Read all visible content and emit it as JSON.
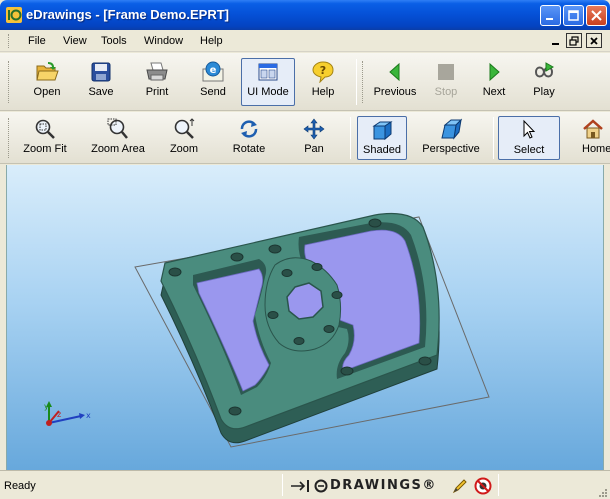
{
  "window": {
    "title": "eDrawings - [Frame Demo.EPRT]"
  },
  "menu": {
    "items": [
      "File",
      "View",
      "Tools",
      "Window",
      "Help"
    ]
  },
  "toolbar1": {
    "open": "Open",
    "save": "Save",
    "print": "Print",
    "send": "Send",
    "ui_mode": "UI Mode",
    "help": "Help",
    "previous": "Previous",
    "stop": "Stop",
    "next": "Next",
    "play": "Play"
  },
  "toolbar2": {
    "zoom_fit": "Zoom Fit",
    "zoom_area": "Zoom Area",
    "zoom": "Zoom",
    "rotate": "Rotate",
    "pan": "Pan",
    "shaded": "Shaded",
    "perspective": "Perspective",
    "select": "Select",
    "home": "Home"
  },
  "status": {
    "text": "Ready",
    "brand": "DRAWINGS®"
  },
  "triad": {
    "x": "x",
    "y": "y",
    "z": "z"
  },
  "colors": {
    "accent": "#0a5fe6",
    "part": "#4a8c7e",
    "face": "#9a97ee",
    "viewport_top": "#d9edfb",
    "viewport_bottom": "#67a8dc"
  }
}
